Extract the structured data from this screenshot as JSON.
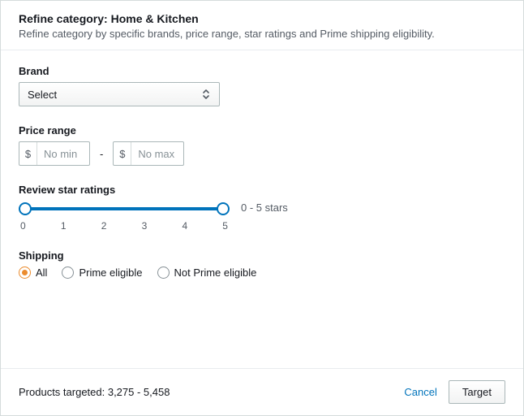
{
  "header": {
    "title": "Refine category: Home & Kitchen",
    "subtitle": "Refine category by specific brands, price range, star ratings and Prime shipping eligibility."
  },
  "brand": {
    "label": "Brand",
    "select_placeholder": "Select"
  },
  "price": {
    "label": "Price range",
    "currency": "$",
    "min_placeholder": "No min",
    "max_placeholder": "No max",
    "separator": "-"
  },
  "ratings": {
    "label": "Review star ratings",
    "range_label": "0 - 5 stars",
    "ticks": [
      "0",
      "1",
      "2",
      "3",
      "4",
      "5"
    ]
  },
  "shipping": {
    "label": "Shipping",
    "options": [
      {
        "label": "All",
        "selected": true
      },
      {
        "label": "Prime eligible",
        "selected": false
      },
      {
        "label": "Not Prime eligible",
        "selected": false
      }
    ]
  },
  "footer": {
    "products_label": "Products targeted: 3,275 - 5,458",
    "cancel": "Cancel",
    "target": "Target"
  }
}
